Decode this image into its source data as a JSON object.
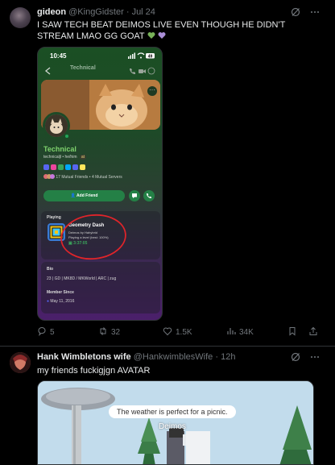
{
  "tweets": [
    {
      "display_name": "gideon",
      "handle": "@KingGidster",
      "separator": "·",
      "date": "Jul 24",
      "text": "I SAW TECH BEAT DEIMOS LIVE EVEN THOUGH HE DIDN'T STREAM LMAO GG GOAT",
      "emoji_colors": [
        "#78b159",
        "#aa8ed6"
      ],
      "embedded_screenshot": {
        "status_time": "10:45",
        "battery": "49",
        "header_title": "Technical",
        "header_sub": "",
        "profile_name": "Technical",
        "profile_handle": "technicaljl • he/him",
        "tag": "at",
        "mutuals": "17 Mutual Friends • 4 Mutual Servers",
        "add_friend_label": "Add Friend",
        "playing_label": "Playing",
        "game_title": "Geometry Dash",
        "game_dev": "Deimos by Hahybrid",
        "game_status": "Playing a level (best: 100%)",
        "game_time": "3:37:05",
        "bio_label": "Bio",
        "bio_text": "23 | GD | MK8D / MKWorld | ARC | zug",
        "member_since_label": "Member Since",
        "member_since_date": "May 11, 2016"
      },
      "actions": {
        "replies": "5",
        "reposts": "32",
        "likes": "1.5K",
        "views": "34K"
      }
    },
    {
      "display_name": "Hank Wimbletons wife",
      "handle": "@HankwimblesWife",
      "separator": "·",
      "date": "12h",
      "text": "my friends fuckigjgn AVATAR",
      "media": {
        "speech_bubble": "The weather is perfect for a picnic.",
        "npc_name": "Deimos"
      }
    }
  ],
  "icons": {
    "grok": "grok-slash-icon",
    "more": "more-dots-icon",
    "reply": "reply-icon",
    "repost": "repost-icon",
    "like": "heart-icon",
    "views": "views-chart-icon",
    "bookmark": "bookmark-icon",
    "share": "share-icon"
  }
}
